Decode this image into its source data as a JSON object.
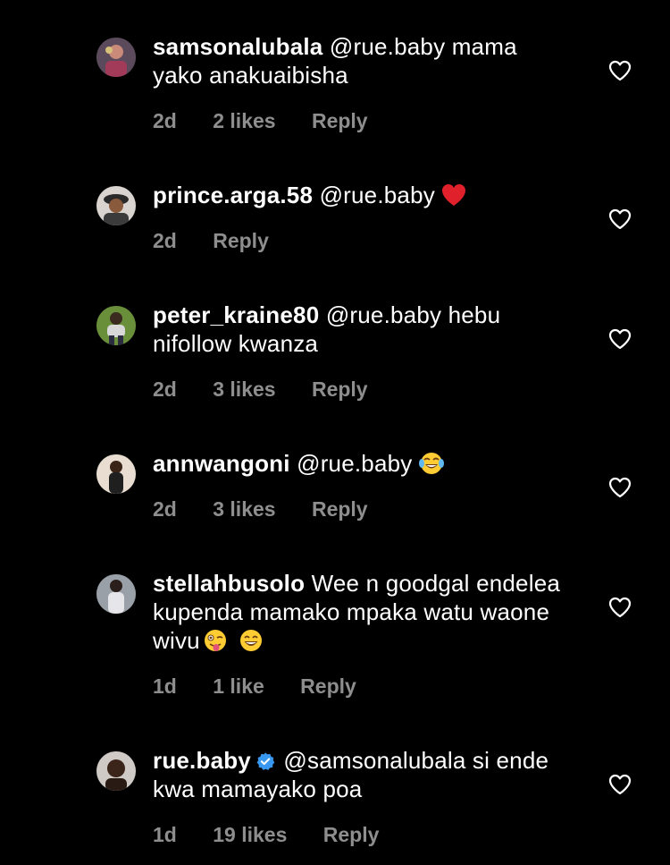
{
  "comments": [
    {
      "username": "samsonalubala",
      "text": "@rue.baby mama yako anakuaibisha",
      "time": "2d",
      "likes": "2 likes",
      "reply": "Reply",
      "avatar_icon": "user-avatar"
    },
    {
      "username": "prince.arga.58",
      "text": "@rue.baby",
      "emoji": "red-heart-emoji",
      "time": "2d",
      "likes": "",
      "reply": "Reply",
      "avatar_icon": "user-avatar"
    },
    {
      "username": "peter_kraine80",
      "text": "@rue.baby hebu nifollow kwanza",
      "time": "2d",
      "likes": "3 likes",
      "reply": "Reply",
      "avatar_icon": "user-avatar"
    },
    {
      "username": "annwangoni",
      "text": "@rue.baby",
      "emoji": "tears-of-joy-emoji",
      "time": "2d",
      "likes": "3 likes",
      "reply": "Reply",
      "avatar_icon": "user-avatar"
    },
    {
      "username": "stellahbusolo",
      "text": "Wee n goodgal endelea kupenda mamako mpaka watu waone wivu",
      "emojis": [
        "winking-tongue-emoji",
        "grinning-emoji"
      ],
      "time": "1d",
      "likes": "1 like",
      "reply": "Reply",
      "avatar_icon": "user-avatar"
    },
    {
      "username": "rue.baby",
      "verified": true,
      "text": "@samsonalubala si ende kwa mamayako poa",
      "time": "1d",
      "likes": "19 likes",
      "reply": "Reply",
      "avatar_icon": "user-avatar"
    }
  ],
  "colors": {
    "background": "#000000",
    "text": "#ffffff",
    "meta": "#8e8e8e",
    "verified": "#3897f0",
    "heart_emoji": "#e0212b"
  },
  "icons": {
    "like": "heart-outline-icon",
    "verified": "verified-badge-icon"
  }
}
